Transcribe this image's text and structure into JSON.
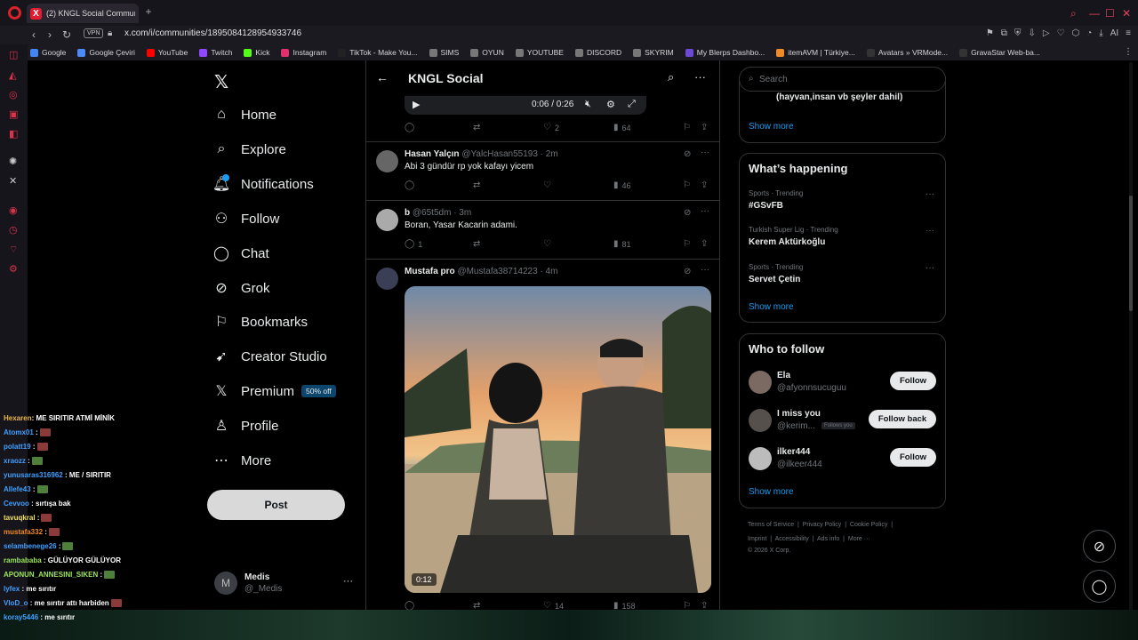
{
  "browser": {
    "tab_title": "(2) KNGL Social Communi",
    "url": "x.com/i/communities/1895084128954933746",
    "vpn_label": "VPN",
    "bookmarks": [
      {
        "label": "Google",
        "color": "#4285f4"
      },
      {
        "label": "Google Çeviri",
        "color": "#4c8bf5"
      },
      {
        "label": "YouTube",
        "color": "#ff0000"
      },
      {
        "label": "Twitch",
        "color": "#9146ff"
      },
      {
        "label": "Kick",
        "color": "#53fc18"
      },
      {
        "label": "Instagram",
        "color": "#e1306c"
      },
      {
        "label": "TikTok - Make You...",
        "color": "#222222"
      },
      {
        "label": "SIMS",
        "color": "#777777"
      },
      {
        "label": "OYUN",
        "color": "#777777"
      },
      {
        "label": "YOUTUBE",
        "color": "#777777"
      },
      {
        "label": "DISCORD",
        "color": "#777777"
      },
      {
        "label": "SKYRIM",
        "color": "#777777"
      },
      {
        "label": "My Blerps Dashbo...",
        "color": "#6b4bd6"
      },
      {
        "label": "itemAVM | Türkiye...",
        "color": "#f08a24"
      },
      {
        "label": "Avatars » VRMode...",
        "color": "#333333"
      },
      {
        "label": "GravaStar Web-ba...",
        "color": "#333333"
      }
    ]
  },
  "nav": {
    "items": [
      {
        "label": "Home",
        "icon": "home-icon"
      },
      {
        "label": "Explore",
        "icon": "search-icon"
      },
      {
        "label": "Notifications",
        "icon": "bell-icon"
      },
      {
        "label": "Follow",
        "icon": "add-person-icon"
      },
      {
        "label": "Chat",
        "icon": "chat-icon"
      },
      {
        "label": "Grok",
        "icon": "grok-icon"
      },
      {
        "label": "Bookmarks",
        "icon": "bookmark-icon"
      },
      {
        "label": "Creator Studio",
        "icon": "rocket-icon"
      },
      {
        "label": "Premium",
        "icon": "x-icon"
      },
      {
        "label": "Profile",
        "icon": "person-icon"
      },
      {
        "label": "More",
        "icon": "more-circle-icon"
      }
    ],
    "premium_badge": "50% off",
    "post_label": "Post",
    "account": {
      "initial": "M",
      "name": "Medis",
      "handle": "@_Medis"
    }
  },
  "main": {
    "title": "KNGL Social",
    "video": {
      "time": "0:06 / 0:26"
    },
    "first_actions": {
      "replies": "",
      "likes": "2",
      "views": "64"
    },
    "tweets": [
      {
        "name": "Hasan Yalçın",
        "handle": "@YalcHasan55193",
        "time": "· 2m",
        "text": "Abi 3 gündür rp yok kafayı yicem",
        "likes": "",
        "views": "46",
        "replies": ""
      },
      {
        "name": "b",
        "handle": "@65t5dm",
        "time": "· 3m",
        "text": "Boran, Yasar Kacarin adami.",
        "replies": "1",
        "likes": "",
        "views": "81"
      },
      {
        "name": "Mustafa pro",
        "handle": "@Mustafa38714223",
        "time": "· 4m",
        "text": "",
        "media_duration": "0:12",
        "replies": "",
        "likes": "14",
        "views": "158"
      }
    ]
  },
  "right": {
    "search_placeholder": "Search",
    "prev_box": {
      "text": "(hayvan,insan vb şeyler dahil)",
      "show_more": "Show more"
    },
    "happening": {
      "title": "What’s happening",
      "trends": [
        {
          "meta": "Sports · Trending",
          "name": "#GSvFB"
        },
        {
          "meta": "Turkish Super Lig · Trending",
          "name": "Kerem Aktürkoğlu"
        },
        {
          "meta": "Sports · Trending",
          "name": "Servet Çetin"
        }
      ],
      "show_more": "Show more"
    },
    "who_to_follow": {
      "title": "Who to follow",
      "users": [
        {
          "name": "Ela",
          "handle": "@afyonnsucuguu",
          "button": "Follow",
          "badge": ""
        },
        {
          "name": "I miss you",
          "handle": "@kerim...",
          "button": "Follow back",
          "badge": "Follows you"
        },
        {
          "name": "ilker444",
          "handle": "@ilkeer444",
          "button": "Follow",
          "badge": ""
        }
      ],
      "show_more": "Show more"
    },
    "footer": {
      "line1": [
        "Terms of Service",
        "Privacy Policy",
        "Cookie Policy"
      ],
      "line2": [
        "Imprint",
        "Accessibility",
        "Ads info",
        "More ···"
      ],
      "copyright": "© 2026 X Corp."
    }
  },
  "chat_overlay": [
    {
      "user": "Hexaren",
      "color": "#e8b64a",
      "msg": ": ME SIRITIR ATMİ MİNİK",
      "emote": ""
    },
    {
      "user": "Atomx01",
      "color": "#3fa0ff",
      "msg": " :",
      "emote": "red"
    },
    {
      "user": "polatt19",
      "color": "#3fa0ff",
      "msg": " :",
      "emote": "red"
    },
    {
      "user": "xraozz",
      "color": "#3fa0ff",
      "msg": " :",
      "emote": "green"
    },
    {
      "user": "yunusaras316962",
      "color": "#3fa0ff",
      "msg": " : ME / SIRITIR",
      "emote": ""
    },
    {
      "user": "Allefe43",
      "color": "#3fa0ff",
      "msg": " :",
      "emote": "green"
    },
    {
      "user": "Cevvoo",
      "color": "#3fa0ff",
      "msg": " : sırtışa bak",
      "emote": ""
    },
    {
      "user": "tavuqkral",
      "color": "#f0e060",
      "msg": " :",
      "emote": "red"
    },
    {
      "user": "mustafa332",
      "color": "#f08a24",
      "msg": " :",
      "emote": "red"
    },
    {
      "user": "selambenege26",
      "color": "#3fa0ff",
      "msg": " :",
      "emote": "green"
    },
    {
      "user": "rambababa",
      "color": "#9be65a",
      "msg": " : GÜLÜYOR GÜLÜYOR",
      "emote": ""
    },
    {
      "user": "APONUN_ANNESINI_SIKEN",
      "color": "#9be65a",
      "msg": " :",
      "emote": "green"
    },
    {
      "user": "lyfex",
      "color": "#3fa0ff",
      "msg": " : me sırıtır",
      "emote": ""
    },
    {
      "user": "VloD_o",
      "color": "#3fa0ff",
      "msg": " : me sırıtır attı harbiden",
      "emote": "red"
    },
    {
      "user": "koray5446",
      "color": "#3fa0ff",
      "msg": " : me sırıtır",
      "emote": ""
    }
  ]
}
